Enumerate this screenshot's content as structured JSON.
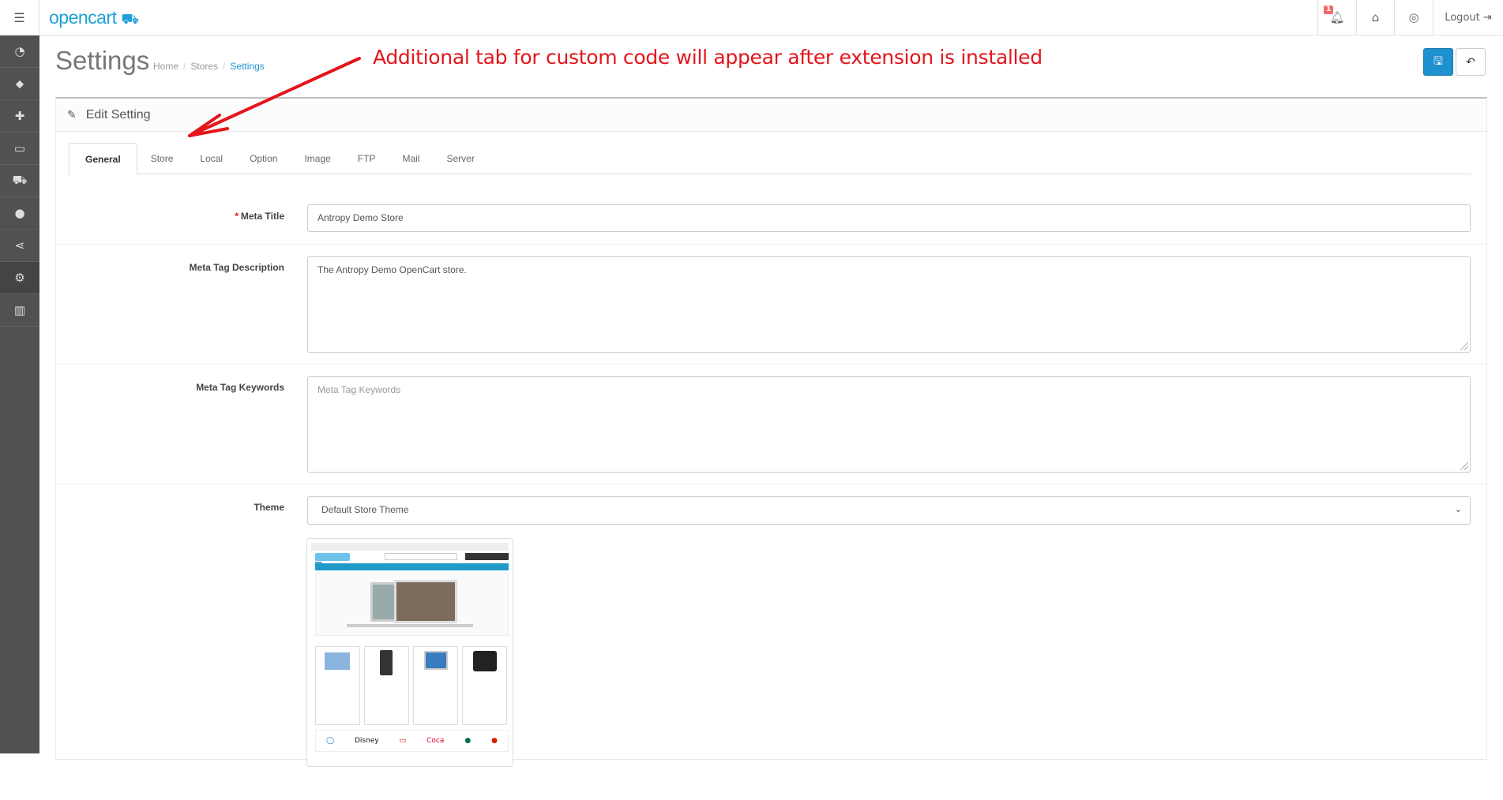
{
  "header": {
    "logo": "opencart",
    "notification_count": "1",
    "logout_label": "Logout"
  },
  "sidebar": {
    "items": [
      {
        "icon": "dashboard-icon"
      },
      {
        "icon": "tags-icon"
      },
      {
        "icon": "puzzle-icon"
      },
      {
        "icon": "desktop-icon"
      },
      {
        "icon": "cart-icon"
      },
      {
        "icon": "user-icon"
      },
      {
        "icon": "share-icon"
      },
      {
        "icon": "gear-icon"
      },
      {
        "icon": "bar-chart-icon"
      }
    ]
  },
  "page": {
    "title": "Settings",
    "breadcrumb": [
      "Home",
      "Stores",
      "Settings"
    ]
  },
  "annotation": {
    "text": "Additional tab for custom code will appear after extension is installed",
    "color": "#e3151b"
  },
  "panel": {
    "heading": "Edit Setting"
  },
  "tabs": [
    "General",
    "Store",
    "Local",
    "Option",
    "Image",
    "FTP",
    "Mail",
    "Server"
  ],
  "form": {
    "meta_title": {
      "label": "Meta Title",
      "value": "Antropy Demo Store",
      "required": true
    },
    "meta_description": {
      "label": "Meta Tag Description",
      "value": "The Antropy Demo OpenCart store."
    },
    "meta_keywords": {
      "label": "Meta Tag Keywords",
      "placeholder": "Meta Tag Keywords",
      "value": ""
    },
    "theme": {
      "label": "Theme",
      "value": "Default Store Theme"
    }
  },
  "colors": {
    "primary": "#1e91cf",
    "sidebar": "#515151",
    "logo": "#1ea1d8"
  }
}
